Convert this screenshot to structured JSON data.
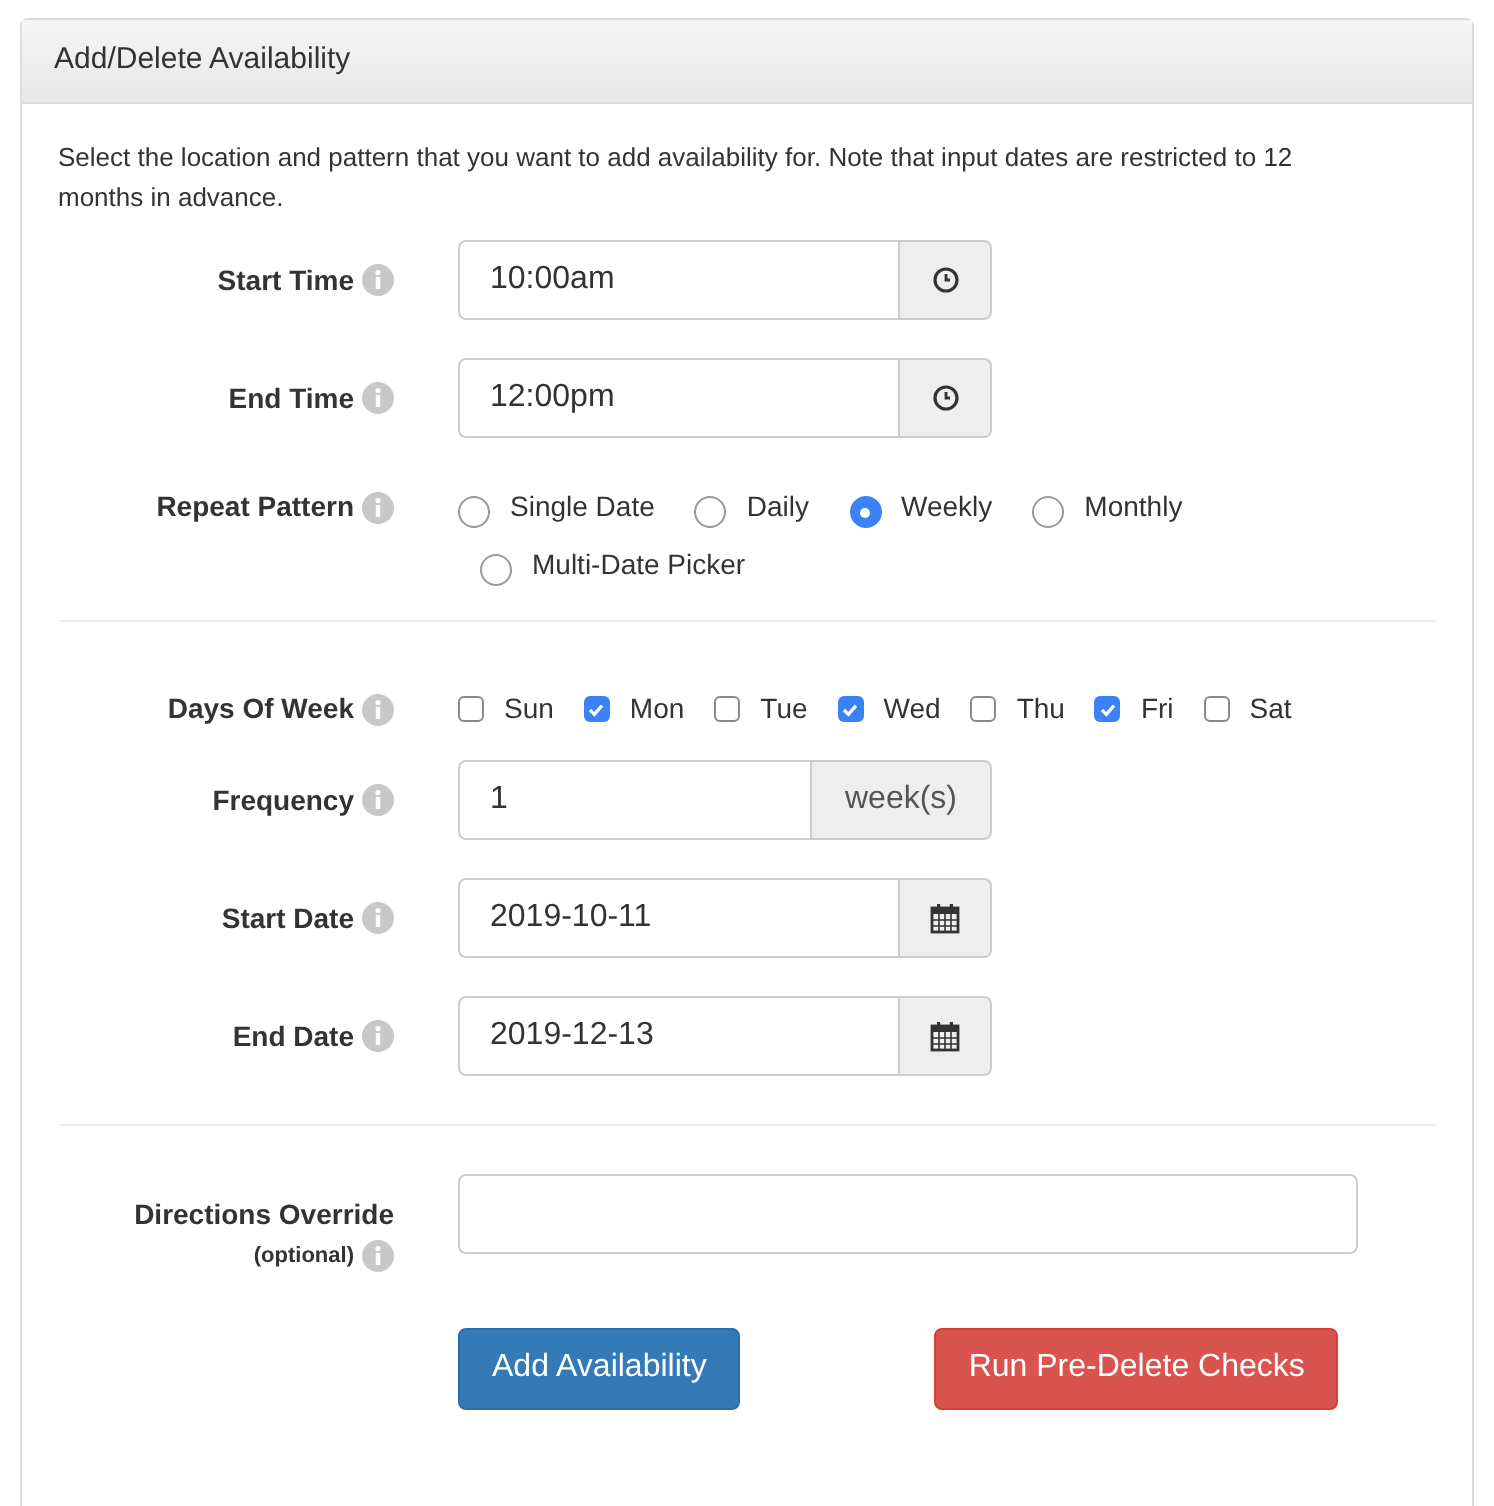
{
  "panel": {
    "title": "Add/Delete Availability",
    "intro": "Select the location and pattern that you want to add availability for. Note that input dates are restricted to 12 months in advance."
  },
  "time_fields": [
    {
      "label": "Start Time",
      "value": "10:00am"
    },
    {
      "label": "End Time",
      "value": "12:00pm"
    }
  ],
  "repeat_pattern": {
    "label": "Repeat Pattern",
    "options": [
      {
        "label": "Single Date",
        "selected": false
      },
      {
        "label": "Daily",
        "selected": false
      },
      {
        "label": "Weekly",
        "selected": true
      },
      {
        "label": "Monthly",
        "selected": false
      },
      {
        "label": "Multi-Date Picker",
        "selected": false
      }
    ]
  },
  "days_of_week": {
    "label": "Days Of Week",
    "days": [
      {
        "label": "Sun",
        "checked": false
      },
      {
        "label": "Mon",
        "checked": true
      },
      {
        "label": "Tue",
        "checked": false
      },
      {
        "label": "Wed",
        "checked": true
      },
      {
        "label": "Thu",
        "checked": false
      },
      {
        "label": "Fri",
        "checked": true
      },
      {
        "label": "Sat",
        "checked": false
      }
    ]
  },
  "frequency": {
    "label": "Frequency",
    "value": "1",
    "unit": "week(s)"
  },
  "date_fields": [
    {
      "label": "Start Date",
      "value": "2019-10-11"
    },
    {
      "label": "End Date",
      "value": "2019-12-13"
    }
  ],
  "directions_override": {
    "label": "Directions Override",
    "note": "(optional)"
  },
  "buttons": [
    {
      "label": "Add Availability",
      "kind": "primary"
    },
    {
      "label": "Run Pre-Delete Checks",
      "kind": "danger"
    }
  ]
}
